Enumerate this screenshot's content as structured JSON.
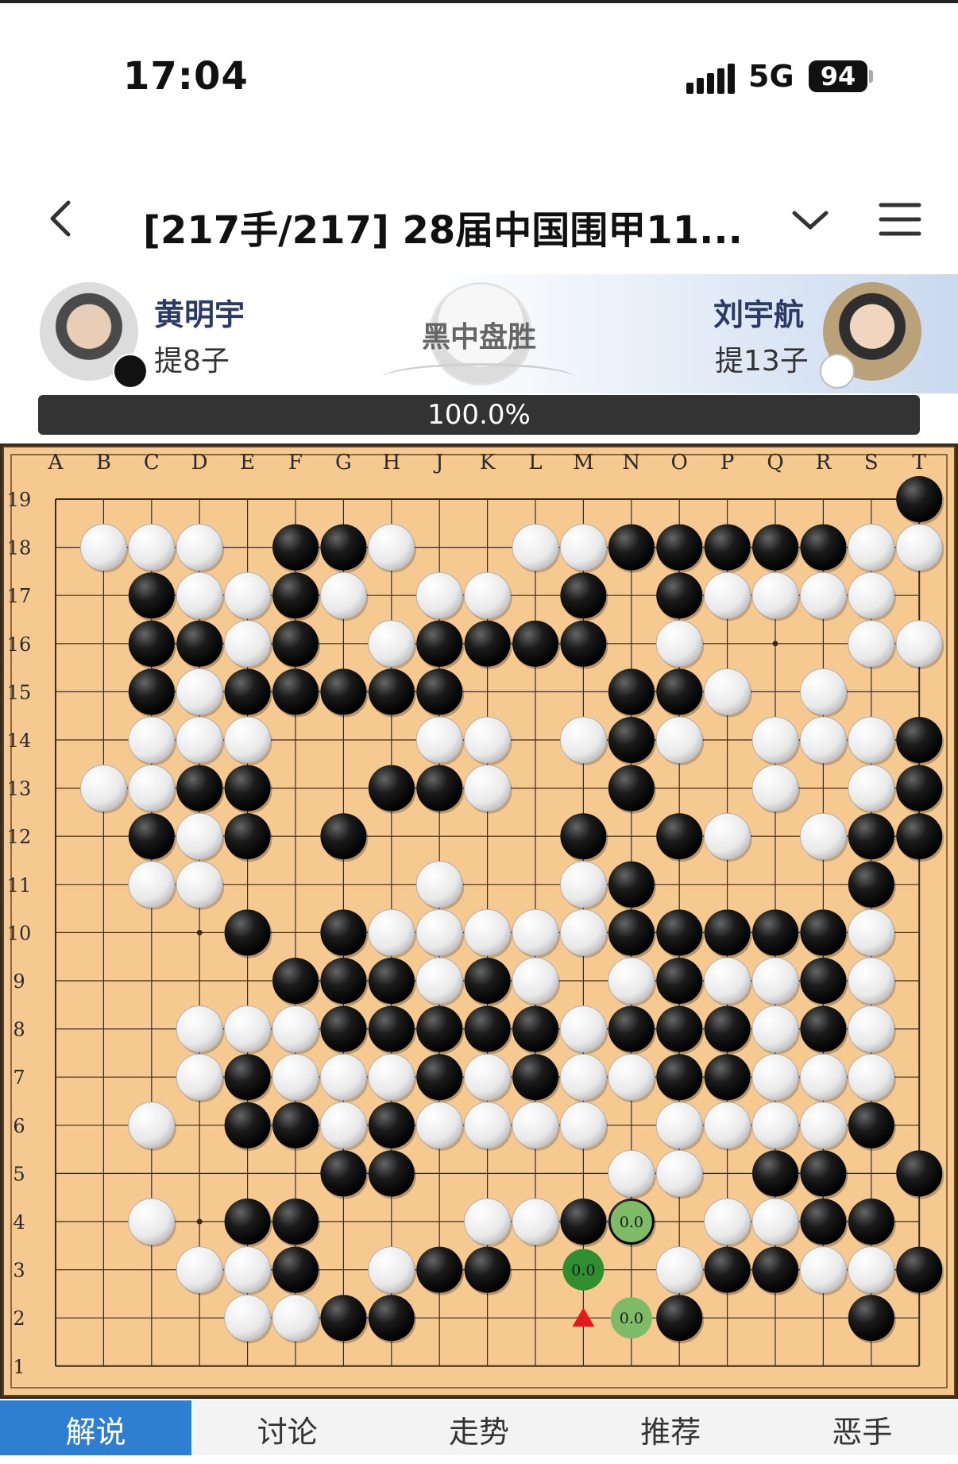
{
  "status_bar": {
    "time": "17:04",
    "network": "5G",
    "battery": "94"
  },
  "nav": {
    "title": "[217手/217] 28届中国围甲11...",
    "icons": [
      "back-chevron-icon",
      "chevron-down-icon",
      "menu-icon"
    ]
  },
  "players": {
    "black": {
      "name": "黄明宇",
      "captures": "提8子"
    },
    "white": {
      "name": "刘宇航",
      "captures": "提13子"
    },
    "result": "黑中盘胜",
    "win_rate": "100.0%"
  },
  "board": {
    "size": 19,
    "cols": [
      "A",
      "B",
      "C",
      "D",
      "E",
      "F",
      "G",
      "H",
      "J",
      "K",
      "L",
      "M",
      "N",
      "O",
      "P",
      "Q",
      "R",
      "S",
      "T"
    ],
    "rows": [
      "19",
      "18",
      "17",
      "16",
      "15",
      "14",
      "13",
      "12",
      "11",
      "10",
      "9",
      "8",
      "7",
      "6",
      "5",
      "4",
      "3",
      "2",
      "1"
    ],
    "stones": [
      "..................B",
      ".WWW.BBW..WWBBBBBWW",
      "..BWWBW.WW.B.BWWWW.",
      "..BBWB.WBBBB.W...WW",
      "..BWBBBBB...BBW.W..",
      "..WWW...WW.WBW.WWWB",
      ".WWBB..BBW..B..W.WB",
      "..BWB.B....B.BW.WBB",
      "..WW....W..WB....B.",
      "....B.BWWWWWBBBBBW.",
      ".....BBBWBW.WBWWBW.",
      "...WWWBBBBBWBBBWBW.",
      "...WBWWWBWBWWBBWWW.",
      "..W.BBWBWWWW.WWWWB.",
      "......BB....WW.BB.B",
      "..W.BB...WWBB.WWBB.",
      "...WWB.WBB...WBBWWB",
      "....WWBB.....B...B.",
      "..................."
    ],
    "last_move": "M2",
    "markers": [
      {
        "point": "N4",
        "label": "0.0",
        "color": "#7dbb67"
      },
      {
        "point": "M3",
        "label": "0.0",
        "color": "#2f8f2f"
      },
      {
        "point": "N2",
        "label": "0.0",
        "color": "#7dbb67"
      }
    ],
    "star_points": [
      "D4",
      "K4",
      "Q4",
      "D10",
      "K10",
      "Q10",
      "D16",
      "K16",
      "Q16"
    ]
  },
  "tabs": [
    {
      "label": "解说",
      "active": true
    },
    {
      "label": "讨论",
      "active": false
    },
    {
      "label": "走势",
      "active": false
    },
    {
      "label": "推荐",
      "active": false
    },
    {
      "label": "恶手",
      "active": false
    }
  ]
}
